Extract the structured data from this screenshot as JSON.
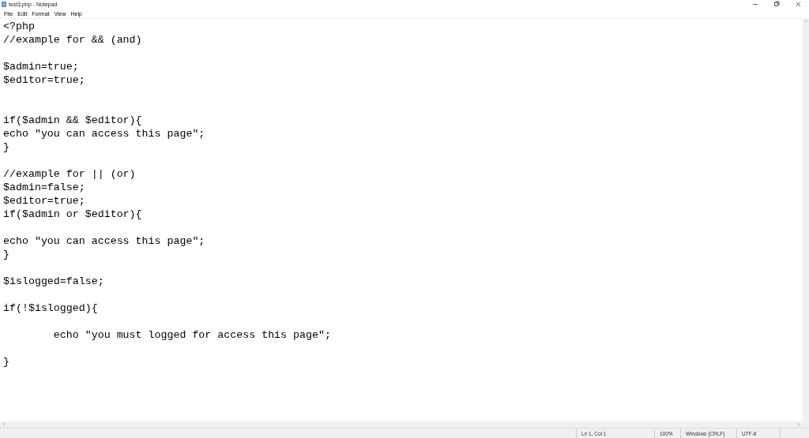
{
  "window": {
    "title": "test3.php - Notepad"
  },
  "menu": [
    "File",
    "Edit",
    "Format",
    "View",
    "Help"
  ],
  "editor": {
    "content": "<?php\n//example for && (and)\n\n$admin=true;\n$editor=true;\n\n\nif($admin && $editor){\necho \"you can access this page\";\n}\n\n//example for || (or)\n$admin=false;\n$editor=true;\nif($admin or $editor){\n\necho \"you can access this page\";\n}\n\n$islogged=false;\n\nif(!$islogged){\n\n\techo \"you must logged for access this page\";\n\n}"
  },
  "status_bar": [
    "Ln 1, Col 1",
    "100%",
    "Windows (CRLF)",
    "UTF-8"
  ]
}
